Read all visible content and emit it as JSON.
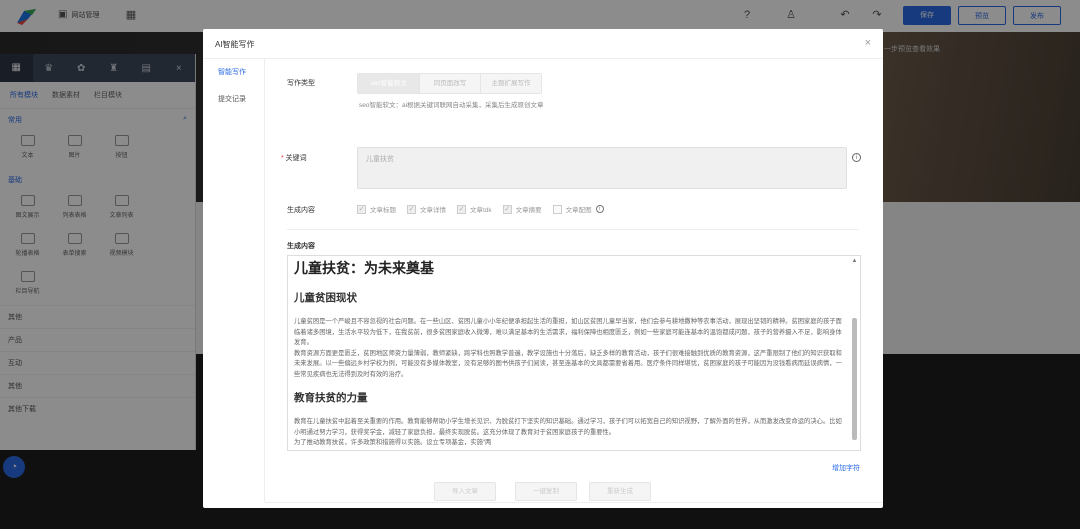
{
  "topbar": {
    "site_manage_label": "网站管理",
    "help_icon": "help-icon",
    "save_label": "保存",
    "preview_label": "预览",
    "publish_label": "发布"
  },
  "hero": {
    "text": "一步预览查看效果"
  },
  "left_panel": {
    "subtabs": [
      "所有模块",
      "数据素材",
      "栏目模块"
    ],
    "section_common": "常用",
    "common_items": [
      "文本",
      "图片",
      "按钮"
    ],
    "section_basic": "基础",
    "basic_items": [
      "图文展示",
      "列表表格",
      "文章列表",
      "轮播表格",
      "表单搜索",
      "视频模块",
      "栏目导航"
    ],
    "rows": [
      "其他",
      "产品",
      "互动",
      "其他",
      "其他下载"
    ]
  },
  "modal": {
    "title": "AI智能写作",
    "close": "×",
    "side_items": [
      "智能写作",
      "提交记录"
    ],
    "write_type_label": "写作类型",
    "write_types": [
      "seo智能软文",
      "同页面改写",
      "主题扩展写作"
    ],
    "hint": "seo智能软文：ai根据关键词联网自动采集，采集后生成原创文章",
    "keyword_label": "关键词",
    "keyword_placeholder": "儿童扶贫",
    "generate_label": "生成内容",
    "options": [
      "文章标题",
      "文章详情",
      "文章tdk",
      "文章摘要",
      "文章配图"
    ],
    "output_label": "生成内容",
    "article": {
      "title": "儿童扶贫：为未来奠基",
      "h2_1": "儿童贫困现状",
      "p1": "儿童贫困是一个严峻且不容忽视的社会问题。在一些山区、贫困儿童小小年纪便承担起生活的重担，如山区贫困儿童早当家，他们会参与耕地撒种等农事活动，展现出坚韧的精神。贫困家庭的孩子面临着诸多困境，生活水平较为低下，在我贫前，很多贫困家庭收入微薄，难以满足基本的生活需求，福利保障也相度匮乏，例如一些家庭可能连基本的温饱都成问题，孩子的营养摄入不足，影响身体发育。",
      "p2": "教育资源方面更是匮乏，贫困地区师资力量薄弱，教师紧缺，跨学科也照教学普遍，教学设施也十分落后，缺乏多样的教育活动，孩子们很难接触到优质的教育资源，这严重限制了他们的知识获取和未来发展。以一些偏远乡村学校为例，可能没有多媒体教室，没有足够的图书供孩子们阅读，甚至连基本的文具都需要省着用。医疗条件同样堪忧，贫困家庭的孩子可能因为没钱看病而延误病情，一些常见疾病也无法得到及时有效的治疗。",
      "h2_2": "教育扶贫的力量",
      "p3": "教育在儿童扶贫中起着至关重要的作用。教育能够帮助小学生增长见识、为脱贫打下坚实的知识基础。通过学习，孩子们可以拓宽自己的知识视野，了解外面的世界，从而激发改变命运的决心。比如小明通过努力学习，获得奖学金，减轻了家庭负担，最终实现脱贫。这充分体现了教育对于贫困家庭孩子的重要性。",
      "p4": "为了推动教育扶贫，许多政策和措施得以实施。设立专项基金，实施“两"
    },
    "add_chars": "增加字符",
    "footer_buttons": [
      "导入文章",
      "一键复制",
      "重新生成"
    ]
  }
}
